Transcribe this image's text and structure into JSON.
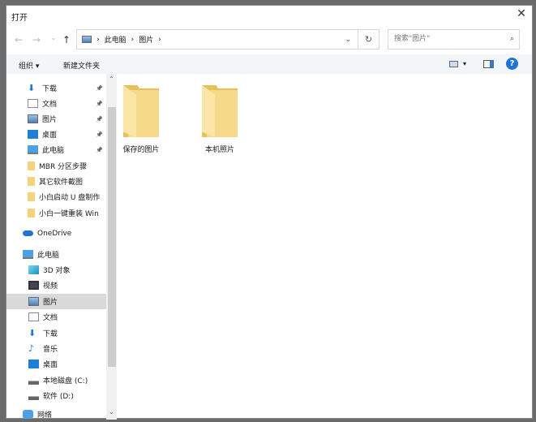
{
  "window": {
    "title": "打开",
    "close": "✕"
  },
  "address": {
    "nav_back": "←",
    "nav_forward": "→",
    "nav_recent": "⌄",
    "nav_up": "↑",
    "crumbs": [
      "此电脑",
      "图片"
    ],
    "sep": "›",
    "dropdown": "⌄",
    "refresh": "↻"
  },
  "search": {
    "placeholder": "搜索\"图片\"",
    "icon": "⌕"
  },
  "toolbar": {
    "organize": "组织 ▾",
    "new_folder": "新建文件夹",
    "view": "▾",
    "help": "?"
  },
  "sidebar": {
    "items": [
      {
        "label": "下载",
        "icon": "download-icon",
        "pinned": true
      },
      {
        "label": "文档",
        "icon": "document-icon",
        "pinned": true
      },
      {
        "label": "图片",
        "icon": "pictures-icon",
        "pinned": true
      },
      {
        "label": "桌面",
        "icon": "desktop-icon",
        "pinned": true
      },
      {
        "label": "此电脑",
        "icon": "computer-icon",
        "pinned": true
      },
      {
        "label": "MBR 分区步骤",
        "icon": "folder-icon"
      },
      {
        "label": "其它软件截图",
        "icon": "folder-icon"
      },
      {
        "label": "小白启动 U 盘制作",
        "icon": "folder-icon"
      },
      {
        "label": "小白一键重装 Win",
        "icon": "folder-icon"
      },
      {
        "label": "OneDrive",
        "icon": "cloud-icon"
      },
      {
        "label": "此电脑",
        "icon": "computer-icon"
      },
      {
        "label": "3D 对象",
        "icon": "cube-icon"
      },
      {
        "label": "视频",
        "icon": "video-icon"
      },
      {
        "label": "图片",
        "icon": "pictures-icon",
        "selected": true
      },
      {
        "label": "文档",
        "icon": "document-icon"
      },
      {
        "label": "下载",
        "icon": "download-icon"
      },
      {
        "label": "音乐",
        "icon": "music-icon"
      },
      {
        "label": "桌面",
        "icon": "desktop-icon"
      },
      {
        "label": "本地磁盘 (C:)",
        "icon": "drive-icon"
      },
      {
        "label": "软件 (D:)",
        "icon": "drive-icon"
      },
      {
        "label": "网络",
        "icon": "network-icon"
      }
    ]
  },
  "files": [
    {
      "name": "保存的图片"
    },
    {
      "name": "本机照片"
    }
  ],
  "colors": {
    "folder": "#f5d37a",
    "accent": "#1f74d1"
  }
}
